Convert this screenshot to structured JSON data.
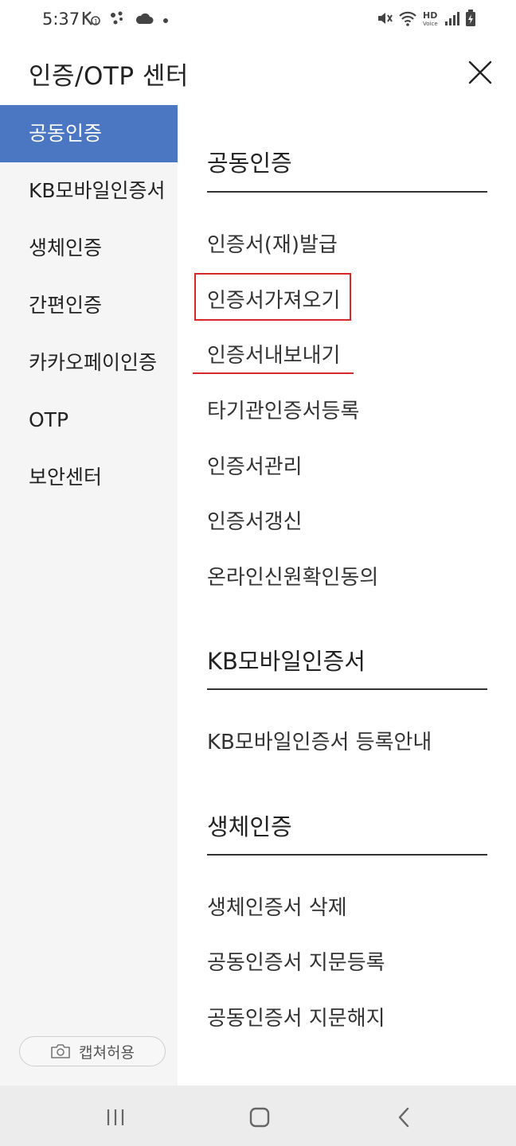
{
  "status_bar": {
    "time": "5:37"
  },
  "header": {
    "title": "인증/OTP 센터"
  },
  "sidebar": {
    "items": [
      {
        "label": "공동인증"
      },
      {
        "label": "KB모바일인증서"
      },
      {
        "label": "생체인증"
      },
      {
        "label": "간편인증"
      },
      {
        "label": "카카오페이인증"
      },
      {
        "label": "OTP"
      },
      {
        "label": "보안센터"
      }
    ],
    "capture_label": "캡쳐허용"
  },
  "content": {
    "sections": [
      {
        "title": "공동인증",
        "items": [
          "인증서(재)발급",
          "인증서가져오기",
          "인증서내보내기",
          "타기관인증서등록",
          "인증서관리",
          "인증서갱신",
          "온라인신원확인동의"
        ]
      },
      {
        "title": "KB모바일인증서",
        "items": [
          "KB모바일인증서 등록안내"
        ]
      },
      {
        "title": "생체인증",
        "items": [
          "생체인증서 삭제",
          "공동인증서 지문등록",
          "공동인증서 지문해지"
        ]
      }
    ]
  },
  "colors": {
    "accent": "#4a76c2",
    "highlight": "#d62828"
  }
}
